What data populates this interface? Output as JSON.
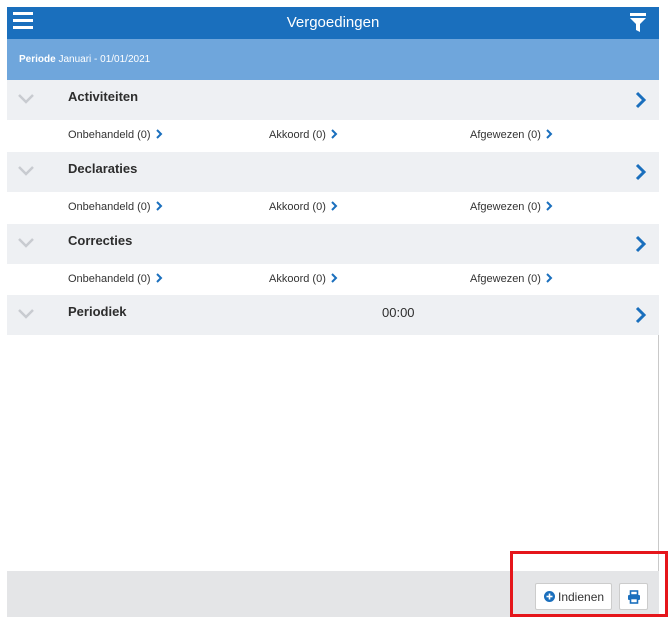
{
  "header": {
    "title": "Vergoedingen",
    "menu_icon": "hamburger-menu-icon",
    "filter_icon": "filter-icon"
  },
  "periode": {
    "label": "Periode",
    "value": "Januari - 01/01/2021"
  },
  "sections": [
    {
      "name": "Activiteiten",
      "onbehandeld": "Onbehandeld (0)",
      "akkoord": "Akkoord (0)",
      "afgewezen": "Afgewezen (0)"
    },
    {
      "name": "Declaraties",
      "onbehandeld": "Onbehandeld (0)",
      "akkoord": "Akkoord (0)",
      "afgewezen": "Afgewezen (0)"
    },
    {
      "name": "Correcties",
      "onbehandeld": "Onbehandeld (0)",
      "akkoord": "Akkoord (0)",
      "afgewezen": "Afgewezen (0)"
    },
    {
      "name": "Periodiek",
      "time": "00:00"
    }
  ],
  "footer": {
    "indienen_label": "Indienen",
    "print_icon": "print-icon"
  },
  "colors": {
    "accent": "#1a6fbd",
    "period_bar": "#6fa6dc",
    "highlight": "#e5161b"
  }
}
